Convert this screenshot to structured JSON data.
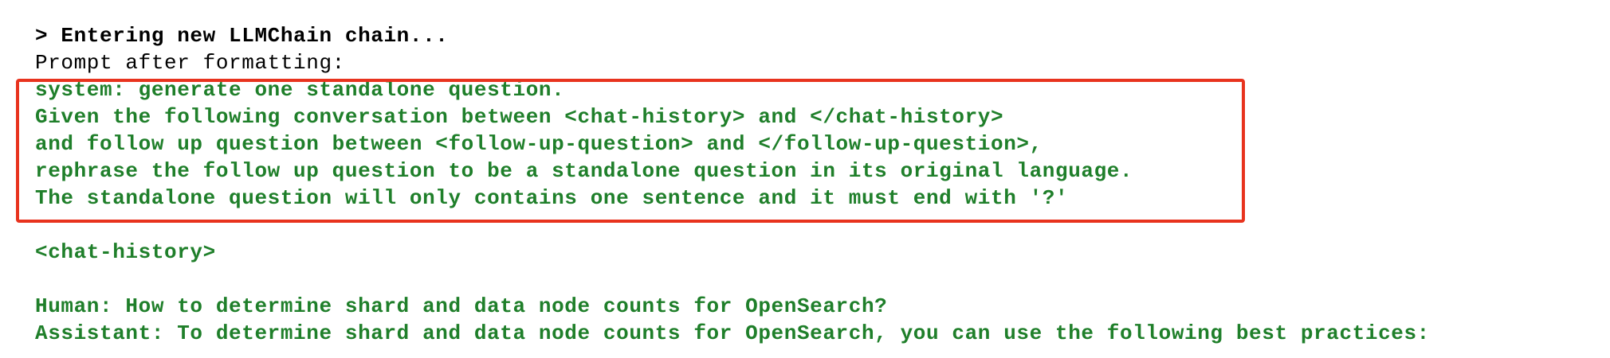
{
  "terminal": {
    "header_line": "> Entering new LLMChain chain...",
    "prompt_label": "Prompt after formatting:",
    "system_lines": [
      "system: generate one standalone question.",
      "Given the following conversation between <chat-history> and </chat-history>",
      "and follow up question between <follow-up-question> and </follow-up-question>,",
      "rephrase the follow up question to be a standalone question in its original language.",
      "The standalone question will only contains one sentence and it must end with '?'"
    ],
    "chat_history_tag": "<chat-history>",
    "human_line": "Human: How to determine shard and data node counts for OpenSearch?",
    "assistant_line": "Assistant: To determine shard and data node counts for OpenSearch, you can use the following best practices:"
  },
  "colors": {
    "output_green": "#1f7f2a",
    "highlight_red": "#e8331e",
    "text_black": "#000000"
  }
}
